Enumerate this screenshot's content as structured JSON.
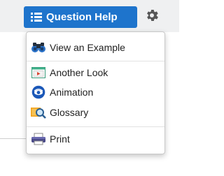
{
  "toolbar": {
    "question_help_label": "Question Help"
  },
  "menu": {
    "items": [
      {
        "label": "View an Example",
        "icon": "binoculars-icon"
      },
      {
        "label": "Another Look",
        "icon": "video-player-icon"
      },
      {
        "label": "Animation",
        "icon": "animation-eye-icon"
      },
      {
        "label": "Glossary",
        "icon": "glossary-magnifier-icon"
      },
      {
        "label": "Print",
        "icon": "printer-icon"
      }
    ]
  },
  "colors": {
    "accent": "#1e74cc",
    "toolbar_bg": "#eff0f1"
  }
}
